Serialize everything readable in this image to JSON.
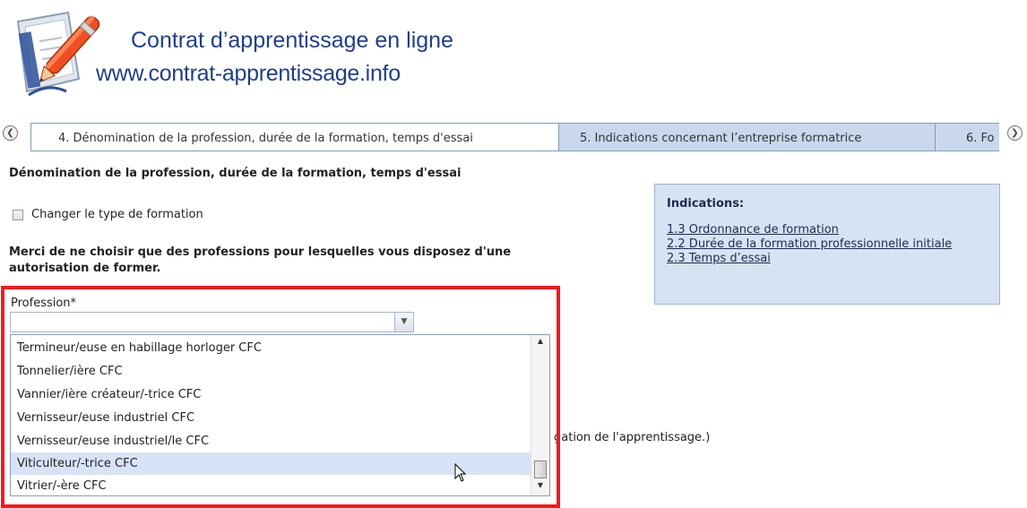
{
  "header": {
    "title": "Contrat d’apprentissage en ligne",
    "url": "www.contrat-apprentissage.info"
  },
  "tabs": [
    {
      "label": "4. Dénomination de la profession, durée de la formation, temps d'essai",
      "active": true
    },
    {
      "label": "5. Indications concernant l’entreprise formatrice",
      "active": false
    },
    {
      "label": "6. Fo",
      "active": false
    }
  ],
  "icons": {
    "prev": "chevron-left-circle-icon",
    "next": "chevron-right-circle-icon",
    "logo": "pen-document-icon"
  },
  "form": {
    "section_title": "Dénomination de la profession, durée de la formation, temps d'essai",
    "checkbox_label": "Changer le type de formation",
    "checkbox_checked": false,
    "note": "Merci de ne choisir que des professions pour lesquelles vous disposez d'une autorisation de former.",
    "profession_label": "Profession*",
    "profession_value": "",
    "background_text": "gation de l'apprentissage.)"
  },
  "indications": {
    "title": "Indications:",
    "links": [
      "1.3 Ordonnance de formation",
      "2.2 Durée de la formation professionnelle initiale",
      "2.3 Temps d’essai"
    ]
  },
  "dropdown": {
    "options": [
      "Termineur/euse en habillage horloger CFC",
      "Tonnelier/ière CFC",
      "Vannier/ière créateur/-trice CFC",
      "Vernisseur/euse industriel CFC",
      "Vernisseur/euse industriel/le CFC",
      "Viticulteur/-trice CFC",
      "Vitrier/-ère CFC"
    ],
    "highlighted": "Viticulteur/-trice CFC"
  },
  "colors": {
    "title": "#1f3f86",
    "tab_inactive": "#c9d8ed",
    "indications_bg": "#d6e3f3",
    "highlight_border": "#ee1c1c",
    "option_hover": "#d7e3f6"
  }
}
